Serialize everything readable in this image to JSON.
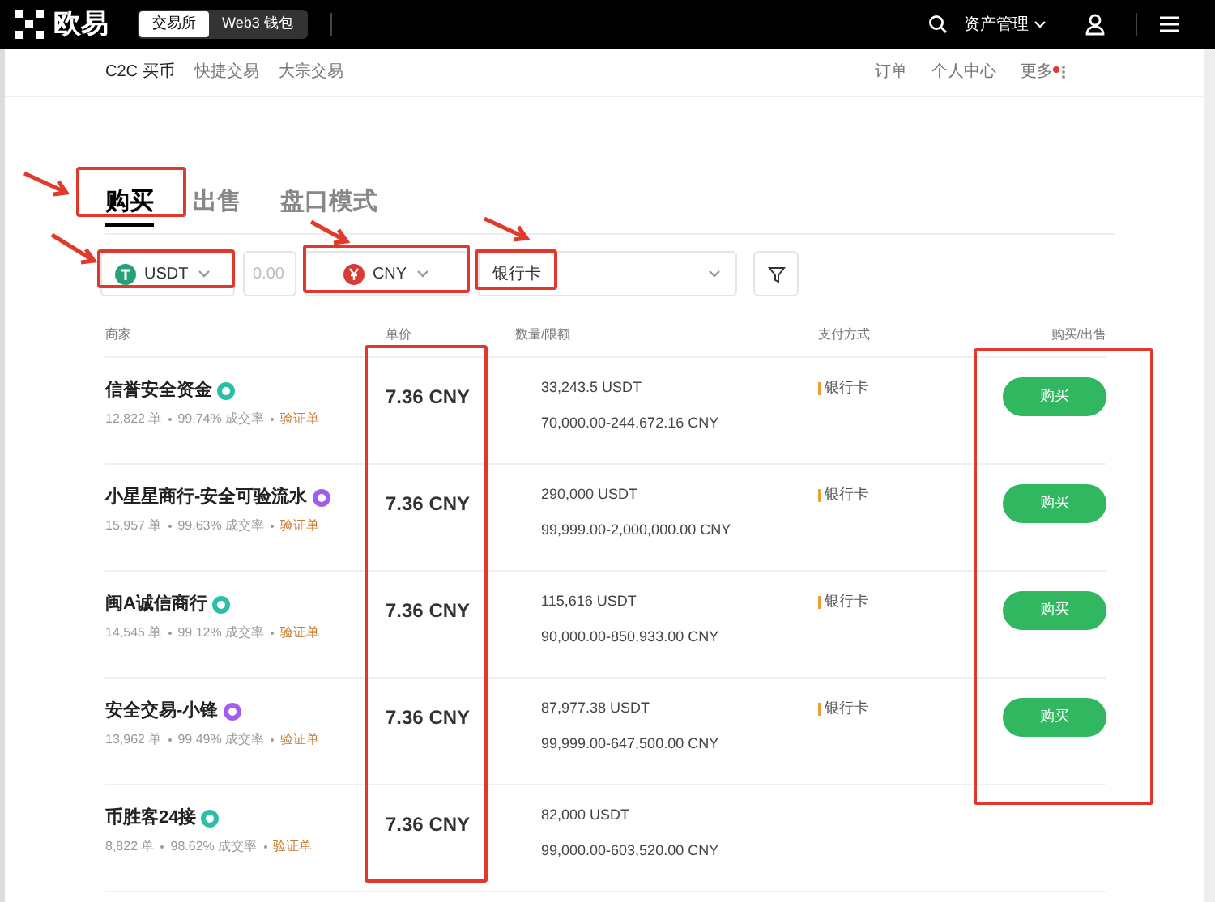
{
  "top_bar": {
    "logo": "欧易",
    "modes": [
      {
        "label": "交易所",
        "selected": true
      },
      {
        "label": "Web3 钱包",
        "selected": false
      }
    ],
    "assets_menu": "资产管理"
  },
  "sub_nav": {
    "left": [
      {
        "label": "C2C 买币",
        "selected": true
      },
      {
        "label": "快捷交易",
        "selected": false
      },
      {
        "label": "大宗交易",
        "selected": false
      }
    ],
    "right": [
      "订单",
      "个人中心",
      "更多"
    ],
    "more_has_dot": true
  },
  "tabs": [
    {
      "label": "购买",
      "selected": true,
      "annotated": true
    },
    {
      "label": "出售",
      "selected": false,
      "annotated": false
    },
    {
      "label": "盘口模式",
      "selected": false,
      "annotated": false
    }
  ],
  "filters": [
    {
      "kind": "coin",
      "value": "USDT",
      "annotated": true
    },
    {
      "kind": "amount",
      "placeholder": "0.00",
      "annotated": false
    },
    {
      "kind": "fiat",
      "value": "CNY",
      "annotated": true
    },
    {
      "kind": "payment",
      "value": "银行卡",
      "annotated": true
    }
  ],
  "table": {
    "columns": [
      {
        "label": "商家",
        "annotated": false
      },
      {
        "label": "单价",
        "annotated": true
      },
      {
        "label": "数量/限额",
        "annotated": false
      },
      {
        "label": "支付方式",
        "annotated": false
      },
      {
        "label": "购买/出售",
        "annotated": true
      }
    ],
    "rows": [
      {
        "merchant": "信誉安全资金",
        "color": "#2bbfa4",
        "orders": "12,822 单",
        "rate": "99.74% 成交率",
        "tag": "验证单",
        "price": "7.36 CNY",
        "quantity": "33,243.5 USDT",
        "limit": "70,000.00-244,672.16 CNY",
        "payment": "银行卡",
        "action": "购买"
      },
      {
        "merchant": "小星星商行-安全可验流水",
        "color": "#a25cf0",
        "orders": "15,957 单",
        "rate": "99.63% 成交率",
        "tag": "验证单",
        "price": "7.36 CNY",
        "quantity": "290,000 USDT",
        "limit": "99,999.00-2,000,000.00 CNY",
        "payment": "银行卡",
        "action": "购买"
      },
      {
        "merchant": "闽A诚信商行",
        "color": "#2bbfa4",
        "orders": "14,545 单",
        "rate": "99.12% 成交率",
        "tag": "验证单",
        "price": "7.36 CNY",
        "quantity": "115,616 USDT",
        "limit": "90,000.00-850,933.00 CNY",
        "payment": "银行卡",
        "action": "购买"
      },
      {
        "merchant": "安全交易-小锋",
        "color": "#a25cf0",
        "orders": "13,962 单",
        "rate": "99.49% 成交率",
        "tag": "验证单",
        "price": "7.36 CNY",
        "quantity": "87,977.38 USDT",
        "limit": "99,999.00-647,500.00 CNY",
        "payment": "银行卡",
        "action": "购买"
      },
      {
        "merchant": "币胜客24接",
        "color": "#2bbfa4",
        "orders": "8,822 单",
        "rate": "98.62% 成交率",
        "tag": "验证单",
        "price": "7.36 CNY",
        "quantity": "82,000 USDT",
        "limit": "99,000.00-603,520.00 CNY"
      }
    ]
  }
}
